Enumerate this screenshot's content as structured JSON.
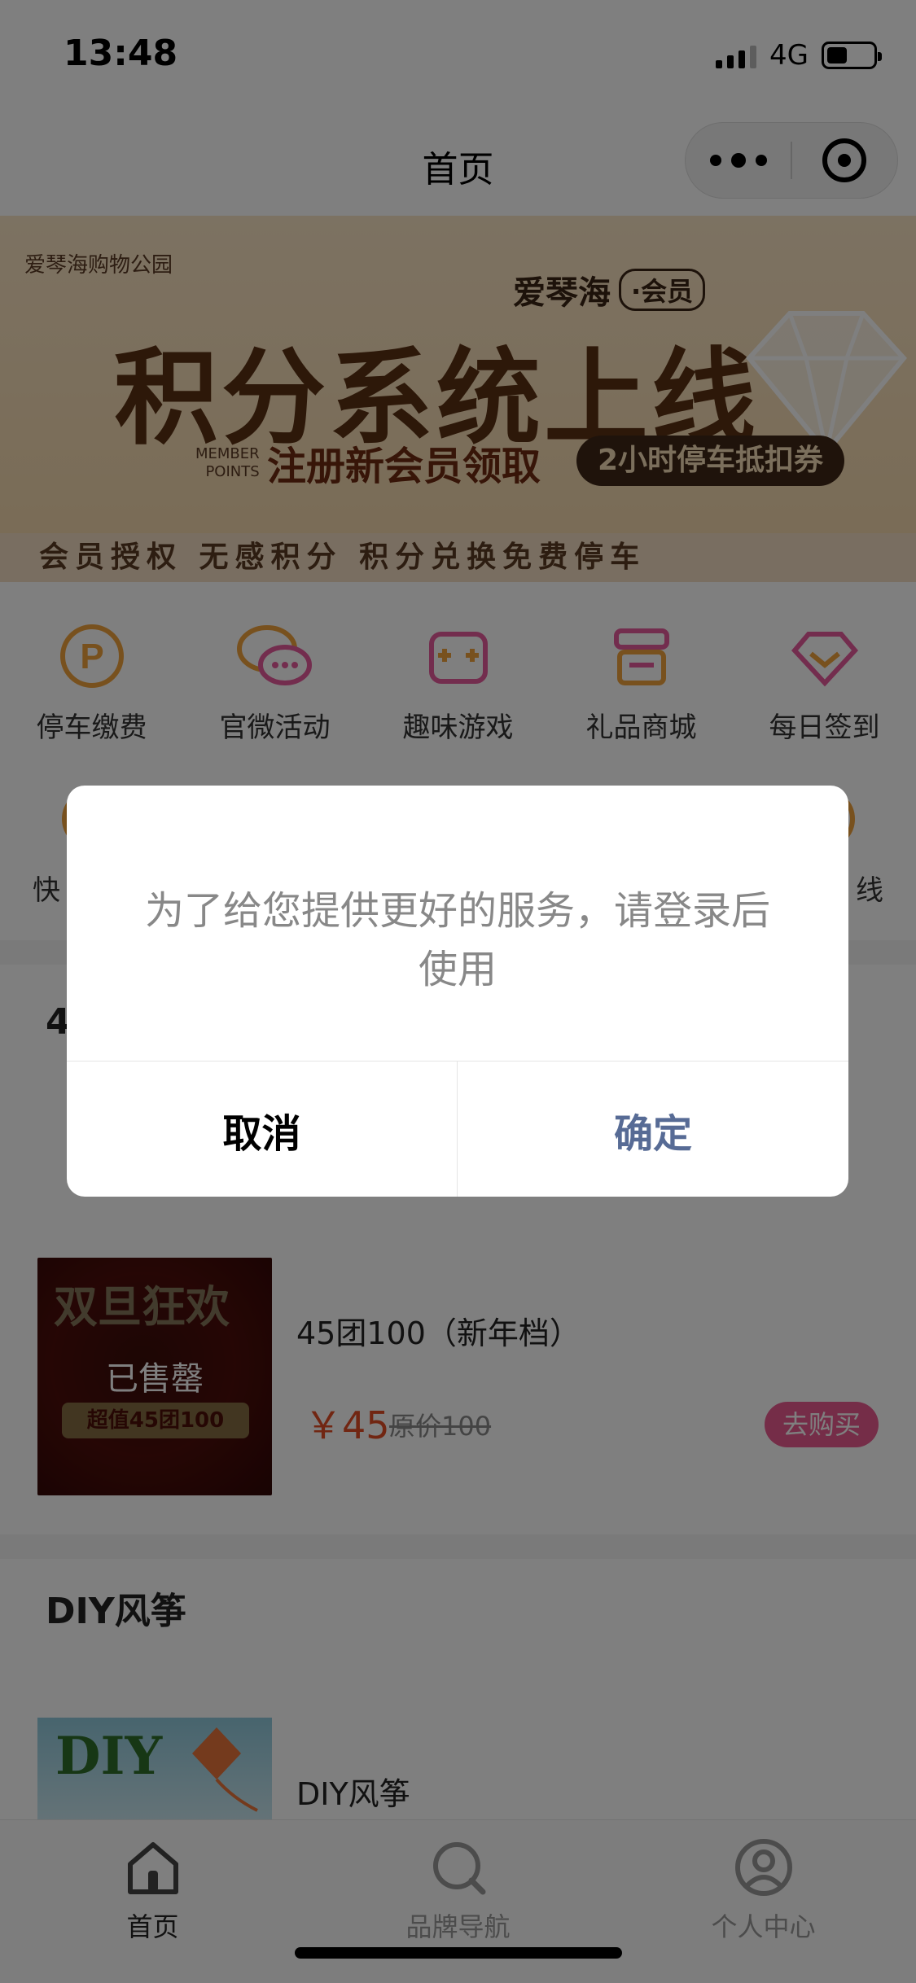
{
  "status_bar": {
    "time": "13:48",
    "network": "4G"
  },
  "nav": {
    "title": "首页"
  },
  "banner": {
    "mall_name": "爱琴海购物公园",
    "brand": "爱琴海",
    "brand_tag": "·会员",
    "title": "积分系统上线",
    "member_line1": "MEMBER",
    "member_line2": "POINTS",
    "subtitle": "注册新会员领取",
    "pill": "2小时停车抵扣券",
    "strip": "会员授权  无感积分  积分兑换免费停车"
  },
  "quick_grid": {
    "row1": [
      {
        "label": "停车缴费",
        "icon": "parking-icon",
        "color": "#f0a23c"
      },
      {
        "label": "官微活动",
        "icon": "chat-bubble-icon",
        "color": "#f0a23c"
      },
      {
        "label": "趣味游戏",
        "icon": "gamepad-icon",
        "color": "#e65a9c"
      },
      {
        "label": "礼品商城",
        "icon": "shop-icon",
        "color": "#e65a9c"
      },
      {
        "label": "每日签到",
        "icon": "gem-icon",
        "color": "#e65a9c"
      }
    ],
    "row2": [
      {
        "label": "快",
        "icon": "quick-icon"
      },
      {
        "label": "线",
        "icon": "online-icon"
      }
    ]
  },
  "group_section": {
    "title": "4",
    "products": [
      {
        "name": "45团100（新年档）",
        "price": "￥45",
        "original": "原价100",
        "status": "已售罄",
        "buy_label": "去购买",
        "thumb_deco": "双旦狂欢",
        "thumb_ribbon": "超值45团100"
      }
    ]
  },
  "diy_section": {
    "title": "DIY风筝",
    "product_name": "DIY风筝",
    "thumb_word": "DIY"
  },
  "tab_bar": {
    "tabs": [
      {
        "label": "首页",
        "icon": "home-icon"
      },
      {
        "label": "品牌导航",
        "icon": "search-icon"
      },
      {
        "label": "个人中心",
        "icon": "user-icon"
      }
    ]
  },
  "modal": {
    "message": "为了给您提供更好的服务，请登录后使用",
    "cancel_label": "取消",
    "confirm_label": "确定"
  },
  "colors": {
    "accent_pink": "#ea5a91",
    "price_orange": "#e24d25",
    "confirm_blue": "#576b95"
  }
}
